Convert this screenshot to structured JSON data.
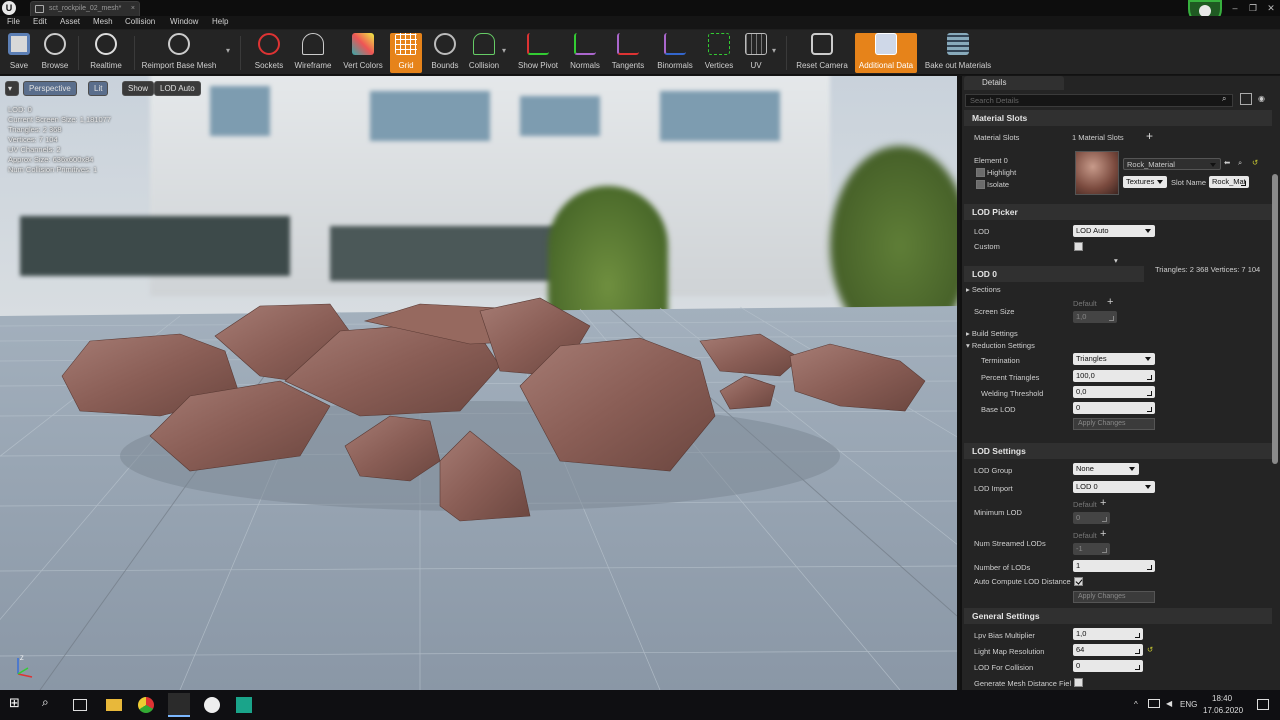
{
  "title_bar": {
    "tab_label": "sct_rockpile_02_mesh*",
    "tab_close": "×",
    "minimize": "–",
    "maximize": "❐",
    "close": "✕"
  },
  "menu": [
    "File",
    "Edit",
    "Asset",
    "Mesh",
    "Collision",
    "Window",
    "Help"
  ],
  "toolbar": [
    "Save",
    "Browse",
    "Realtime",
    "Reimport Base Mesh",
    "Sockets",
    "Wireframe",
    "Vert Colors",
    "Grid",
    "Bounds",
    "Collision",
    "Show Pivot",
    "Normals",
    "Tangents",
    "Binormals",
    "Vertices",
    "UV",
    "Reset Camera",
    "Additional Data",
    "Bake out Materials"
  ],
  "viewport": {
    "buttons": {
      "perspective": "Perspective",
      "lit": "Lit",
      "show": "Show",
      "lod": "LOD Auto"
    },
    "stats": [
      "LOD: 0",
      "Current Screen Size: 1,181077",
      "Triangles: 2 368",
      "Vertices: 7 104",
      "UV Channels: 2",
      "Approx Size: 636x600x84",
      "Num Collision Primitives: 1"
    ],
    "axis": {
      "x": "X",
      "y": "Y",
      "z": "Z"
    }
  },
  "details": {
    "tab": "Details",
    "search_placeholder": "Search Details",
    "material_slots": {
      "header": "Material Slots",
      "label": "Material Slots",
      "count": "1 Material Slots",
      "element": "Element 0",
      "highlight": "Highlight",
      "isolate": "Isolate",
      "material": "Rock_Material",
      "textures": "Textures",
      "slot_name_label": "Slot Name",
      "slot_name": "Rock_Mat"
    },
    "lod_picker": {
      "header": "LOD Picker",
      "lod_label": "LOD",
      "lod_value": "LOD Auto",
      "custom_label": "Custom",
      "stats": "Triangles: 2 368   Vertices: 7 104"
    },
    "lod0": {
      "header": "LOD 0",
      "sections": "Sections",
      "screen_size_label": "Screen Size",
      "default": "Default",
      "screen_size": "1,0",
      "build_settings": "Build Settings",
      "reduction_settings": "Reduction Settings",
      "termination_label": "Termination",
      "termination": "Triangles",
      "percent_label": "Percent Triangles",
      "percent": "100,0",
      "welding_label": "Welding Threshold",
      "welding": "0,0",
      "base_lod_label": "Base LOD",
      "base_lod": "0",
      "apply": "Apply Changes"
    },
    "lod_settings": {
      "header": "LOD Settings",
      "group_label": "LOD Group",
      "group": "None",
      "import_label": "LOD Import",
      "import": "LOD 0",
      "min_lod_label": "Minimum LOD",
      "default": "Default",
      "min_lod": "0",
      "streamed_label": "Num Streamed LODs",
      "streamed": "-1",
      "num_lods_label": "Number of LODs",
      "num_lods": "1",
      "auto_label": "Auto Compute LOD Distance",
      "apply": "Apply Changes"
    },
    "general": {
      "header": "General Settings",
      "lpv_label": "Lpv Bias Multiplier",
      "lpv": "1,0",
      "lightmap_label": "Light Map Resolution",
      "lightmap": "64",
      "lod_collision_label": "LOD For Collision",
      "lod_collision": "0",
      "distance_field_label": "Generate Mesh Distance Fiel"
    }
  },
  "taskbar": {
    "lang": "ENG",
    "time": "18:40",
    "date": "17.06.2020",
    "tray_arrow": "^"
  },
  "colors": {
    "accent": "#e6831a",
    "background": "#242424",
    "section": "#303030"
  }
}
